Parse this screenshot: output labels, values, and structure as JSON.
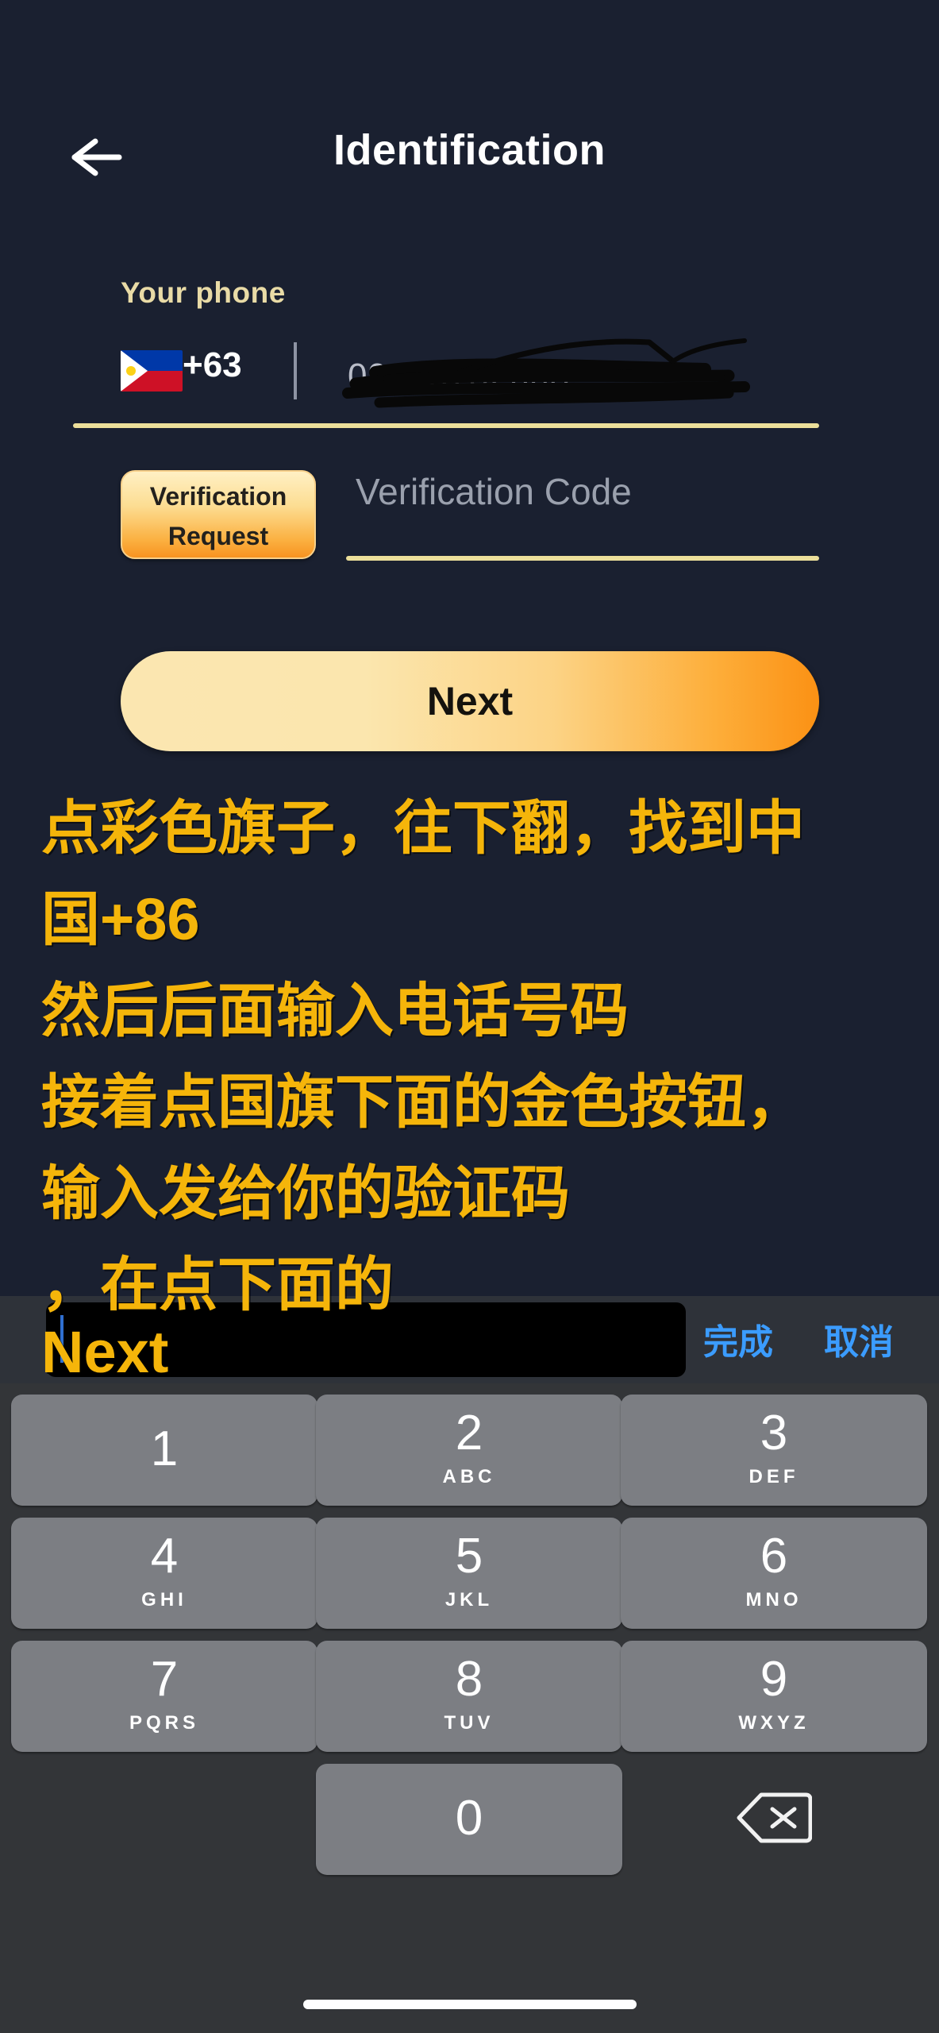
{
  "header": {
    "title": "Identification",
    "back_icon": "arrow-left-icon"
  },
  "form": {
    "phone_label": "Your phone",
    "country_flag": "philippines-flag-icon",
    "dial_code": "+63",
    "phone_number_value": "09108782608",
    "phone_number_redacted": true,
    "verification_request_label_line1": "Verification",
    "verification_request_label_line2": "Request",
    "verification_code_placeholder": "Verification Code",
    "verification_code_value": "",
    "next_label": "Next"
  },
  "annotation": {
    "line1": "点彩色旗子，往下翻，找到中",
    "line2": "国+86",
    "line3": "然后后面输入电话号码",
    "line4": "接着点国旗下面的金色按钮，",
    "line5": "输入发给你的验证码",
    "line6": "，在点下面的",
    "line7": "Next"
  },
  "keyboard": {
    "accessory": {
      "input_value": "",
      "done_label": "完成",
      "cancel_label": "取消"
    },
    "keys": [
      {
        "num": "1",
        "letters": ""
      },
      {
        "num": "2",
        "letters": "ABC"
      },
      {
        "num": "3",
        "letters": "DEF"
      },
      {
        "num": "4",
        "letters": "GHI"
      },
      {
        "num": "5",
        "letters": "JKL"
      },
      {
        "num": "6",
        "letters": "MNO"
      },
      {
        "num": "7",
        "letters": "PQRS"
      },
      {
        "num": "8",
        "letters": "TUV"
      },
      {
        "num": "9",
        "letters": "WXYZ"
      },
      {
        "num": "0",
        "letters": ""
      }
    ],
    "delete_icon": "backspace-icon"
  },
  "colors": {
    "background": "#1a2030",
    "accent_gold": "#f5b50a",
    "underline_gold": "#ecdf9a",
    "keyboard_bg": "#333538",
    "key_bg": "#7c7e83",
    "accessory_blue": "#3b9cff"
  }
}
